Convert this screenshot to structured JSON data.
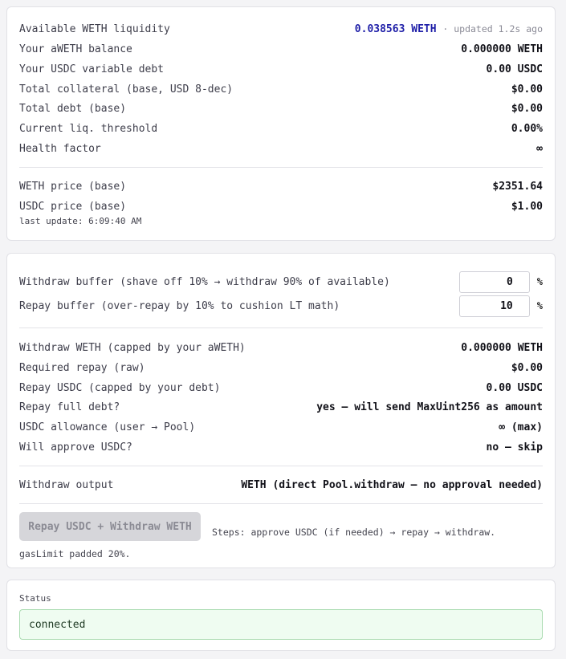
{
  "liquidity": {
    "available_label": "Available WETH liquidity",
    "available_value": "0.038563 WETH",
    "updated_text": "· updated 1.2s ago",
    "rows": [
      {
        "label": "Your aWETH balance",
        "value": "0.000000 WETH"
      },
      {
        "label": "Your USDC variable debt",
        "value": "0.00 USDC"
      },
      {
        "label": "Total collateral (base, USD 8-dec)",
        "value": "$0.00"
      },
      {
        "label": "Total debt (base)",
        "value": "$0.00"
      },
      {
        "label": "Current liq. threshold",
        "value": "0.00%"
      },
      {
        "label": "Health factor",
        "value": "∞"
      }
    ],
    "prices": [
      {
        "label": "WETH price (base)",
        "value": "$2351.64"
      },
      {
        "label": "USDC price (base)",
        "value": "$1.00"
      }
    ],
    "last_update": "last update: 6:09:40 AM"
  },
  "plan": {
    "withdraw_buffer_label": "Withdraw buffer (shave off 10% → withdraw 90% of available)",
    "withdraw_buffer_value": "0",
    "repay_buffer_label": "Repay buffer (over-repay by 10% to cushion LT math)",
    "repay_buffer_value": "10",
    "pct_symbol": "%",
    "rows": [
      {
        "label": "Withdraw WETH (capped by your aWETH)",
        "value": "0.000000 WETH"
      },
      {
        "label": "Required repay (raw)",
        "value": "$0.00"
      },
      {
        "label": "Repay USDC (capped by your debt)",
        "value": "0.00 USDC"
      },
      {
        "label": "Repay full debt?",
        "value": "yes — will send MaxUint256 as amount"
      },
      {
        "label": "USDC allowance (user → Pool)",
        "value": "∞ (max)"
      },
      {
        "label": "Will approve USDC?",
        "value": "no — skip"
      }
    ],
    "output_label": "Withdraw output",
    "output_value": "WETH (direct Pool.withdraw — no approval needed)",
    "button_label": "Repay USDC + Withdraw WETH",
    "steps_text": "Steps: approve USDC (if needed) → repay → withdraw. gasLimit padded 20%."
  },
  "status": {
    "label": "Status",
    "value": "connected"
  },
  "colors": {
    "accent_blue": "#1f1fa8",
    "status_bg": "#effcf1",
    "status_border": "#a9dbb0",
    "button_disabled": "#d6d6da"
  }
}
